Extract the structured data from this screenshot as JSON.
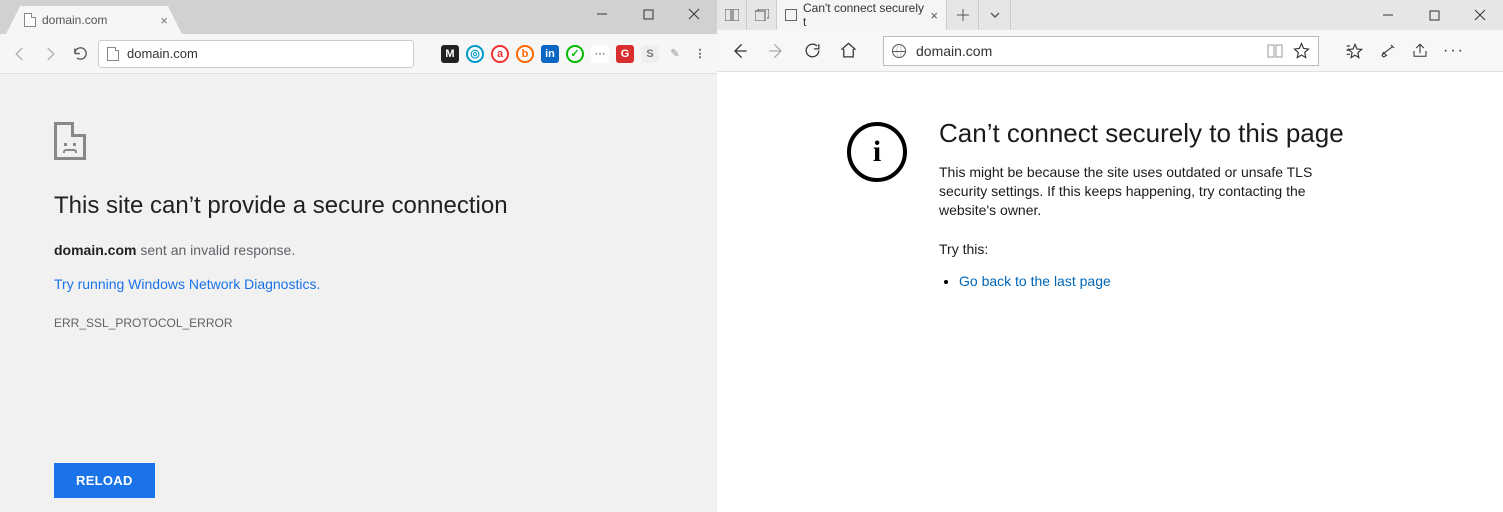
{
  "chrome": {
    "tab_title": "domain.com",
    "address": "domain.com",
    "error": {
      "heading": "This site can’t provide a secure connection",
      "domain": "domain.com",
      "message_suffix": " sent an invalid response.",
      "diagnostics_link": "Try running Windows Network Diagnostics.",
      "error_code": "ERR_SSL_PROTOCOL_ERROR",
      "reload_label": "RELOAD"
    }
  },
  "edge": {
    "tab_title": "Can't connect securely t",
    "address": "domain.com",
    "error": {
      "heading": "Can’t connect securely to this page",
      "body": "This might be because the site uses outdated or unsafe TLS security settings. If this keeps happening, try contacting the website's owner.",
      "try_label": "Try this:",
      "back_link": "Go back to the last page"
    }
  }
}
